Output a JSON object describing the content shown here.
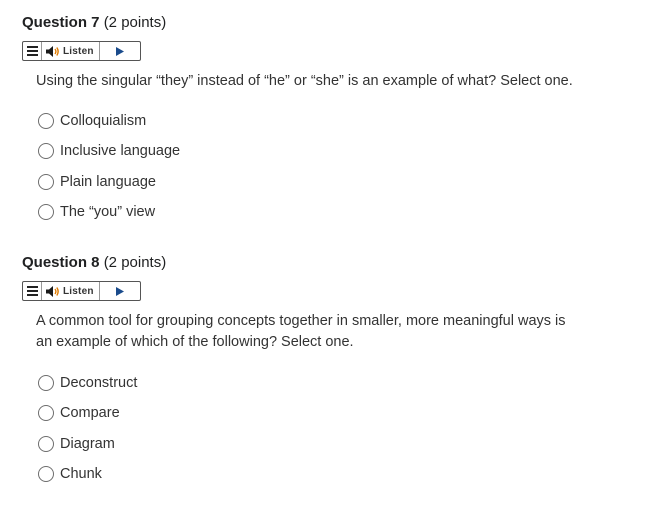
{
  "questions": [
    {
      "number_label": "Question 7",
      "points_label": "(2 points)",
      "listen_label": "Listen",
      "text": "Using the singular “they” instead of “he” or “she” is an example of what? Select one.",
      "options": [
        "Colloquialism",
        "Inclusive language",
        "Plain language",
        "The “you” view"
      ]
    },
    {
      "number_label": "Question 8",
      "points_label": "(2 points)",
      "listen_label": "Listen",
      "text_line1": "A common tool for grouping concepts together in smaller, more meaningful ways is",
      "text_line2": "an example of which of the following? Select one.",
      "options": [
        "Deconstruct",
        "Compare",
        "Diagram",
        "Chunk"
      ]
    }
  ],
  "colors": {
    "text": "#202122",
    "body_text": "#333333",
    "border": "#6e6e6e"
  },
  "icons": [
    "menu-icon",
    "speaker-icon",
    "play-icon"
  ]
}
